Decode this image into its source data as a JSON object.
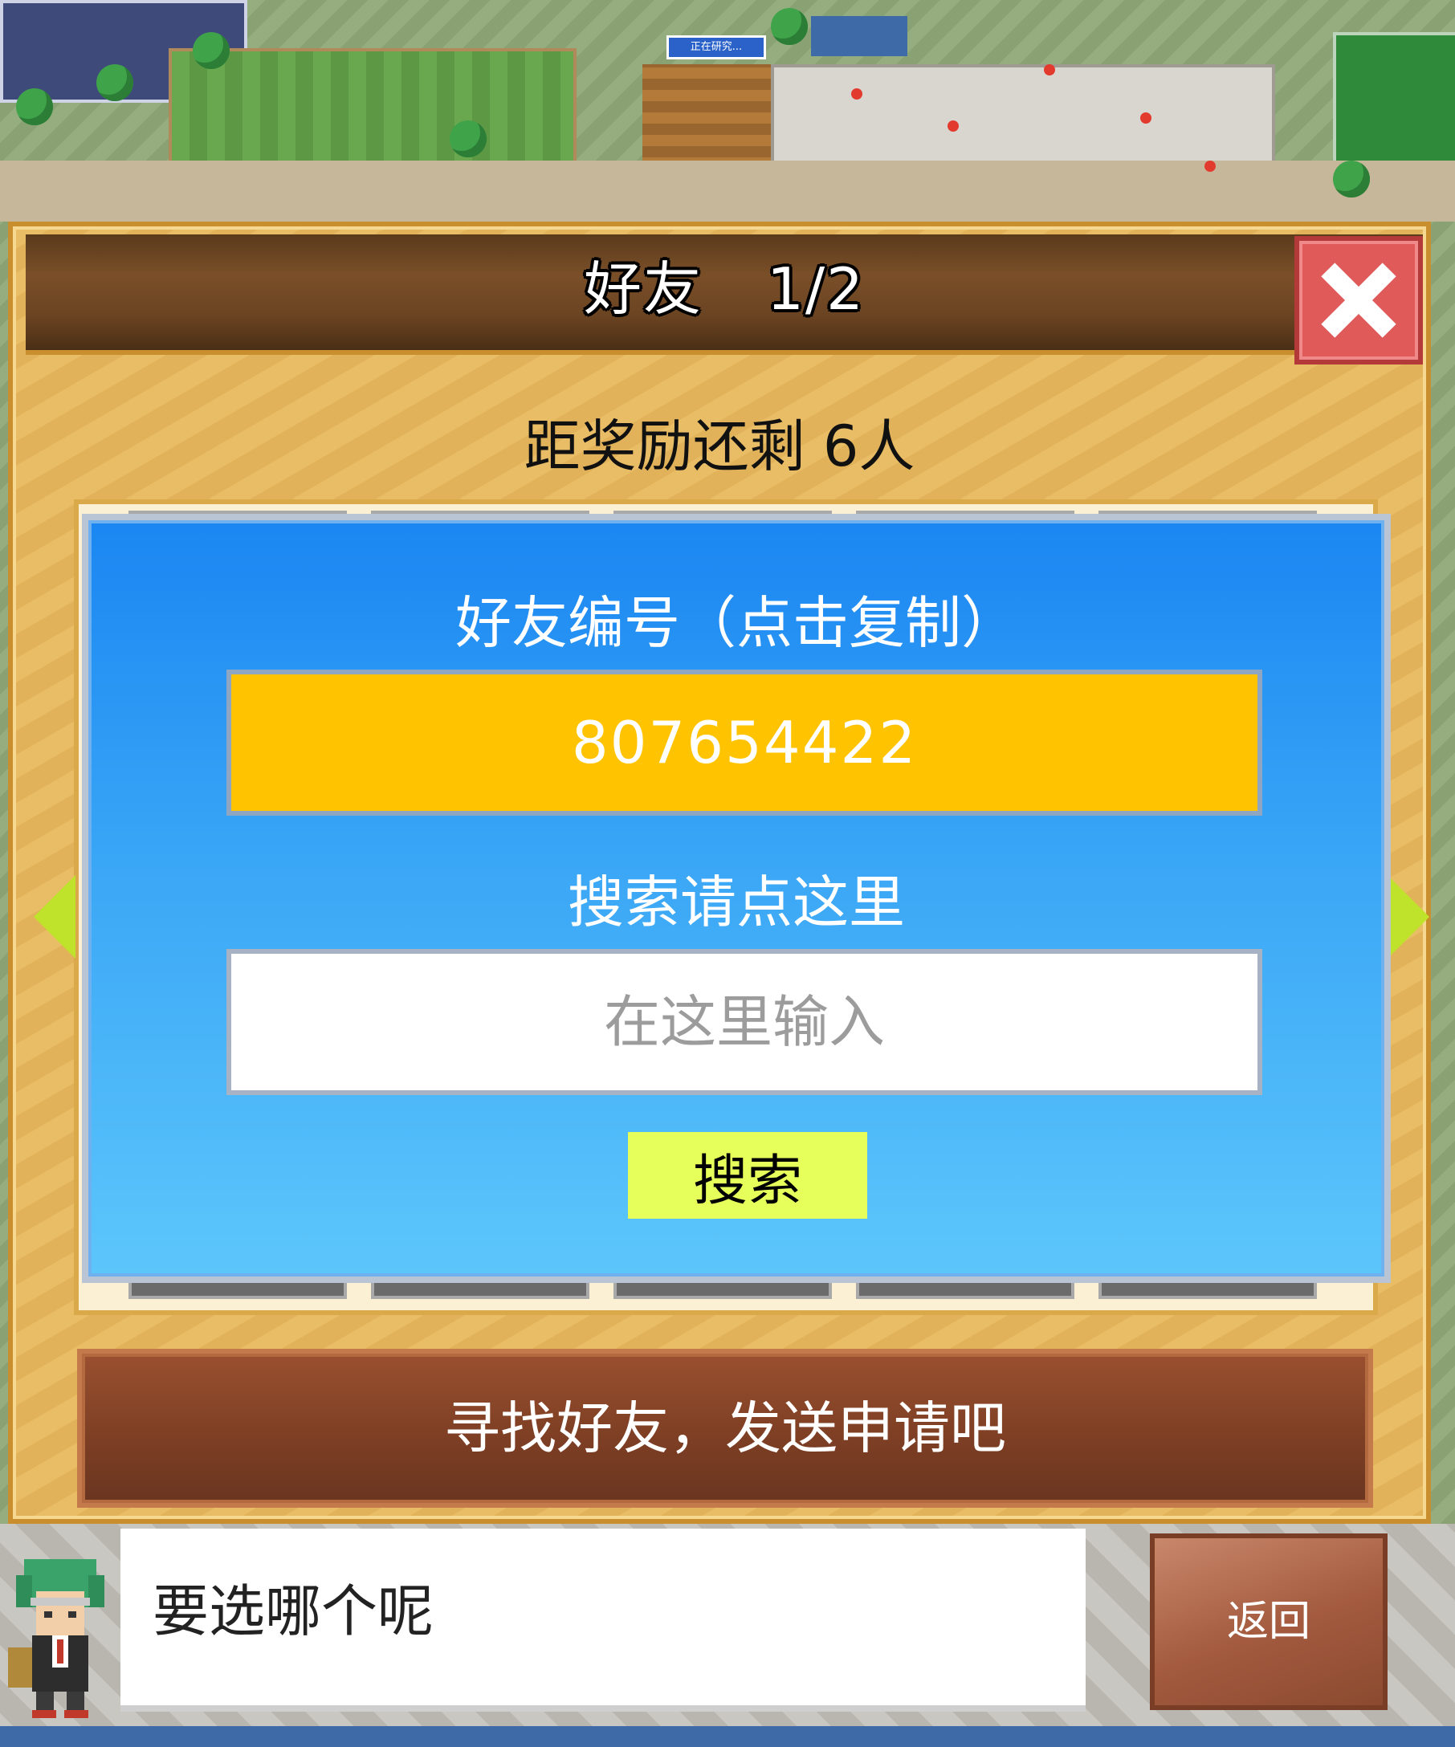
{
  "world": {
    "status_chip": "正在研究..."
  },
  "panel": {
    "title": "好友",
    "page_indicator": "1/2",
    "reward_text": "距奖励还剩 6人"
  },
  "dialog": {
    "id_label": "好友编号（点击复制）",
    "friend_id": "807654422",
    "search_label": "搜索请点这里",
    "search_placeholder": "在这里输入",
    "search_value": "",
    "search_button": "搜索"
  },
  "hint_bar": {
    "text": "寻找好友，发送申请吧"
  },
  "footer": {
    "message": "要选哪个呢",
    "back_button": "返回"
  },
  "icons": {
    "close": "close-icon",
    "left_arrow": "chevron-left-icon",
    "right_arrow": "chevron-right-icon",
    "avatar": "advisor-avatar-icon"
  },
  "colors": {
    "panel_bg": "#e8b85c",
    "dialog_top": "#1a86f2",
    "dialog_bottom": "#5cc6fb",
    "id_box": "#ffc300",
    "search_button": "#e6ff5a",
    "close_button": "#e05a5a",
    "hint_bar": "#7e3f24"
  }
}
